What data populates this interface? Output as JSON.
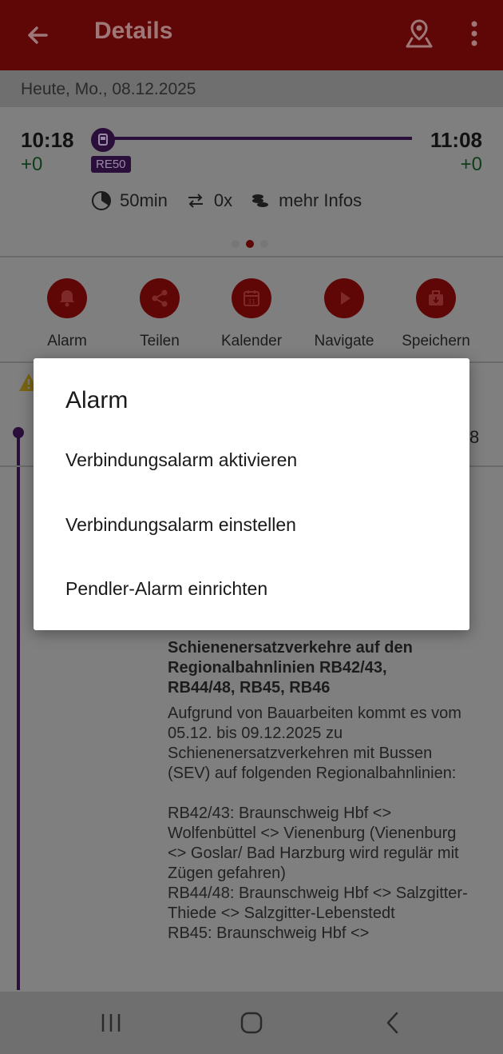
{
  "appbar": {
    "title": "Details"
  },
  "date_label": "Heute, Mo., 08.12.2025",
  "journey": {
    "departure_time": "10:18",
    "departure_delay": "+0",
    "arrival_time": "11:08",
    "arrival_delay": "+0",
    "train_badge": "RE50",
    "duration": "50min",
    "transfers": "0x",
    "more_info": "mehr Infos",
    "page_dots_active": 1
  },
  "actions": [
    {
      "label": "Alarm",
      "icon": "bell-icon"
    },
    {
      "label": "Teilen",
      "icon": "share-icon"
    },
    {
      "label": "Kalender",
      "icon": "calendar-icon"
    },
    {
      "label": "Navigate",
      "icon": "play-icon"
    },
    {
      "label": "Speichern",
      "icon": "save-icon"
    }
  ],
  "calendar_day": "31",
  "content": {
    "edge_digit": "8",
    "notice_title": "Schienenersatzverkehre auf den Regionalbahnlinien RB42/43, RB44/48, RB45, RB46",
    "notice_body": "Aufgrund von Bauarbeiten kommt es vom 05.12. bis 09.12.2025 zu Schienenersatzverkehren mit Bussen (SEV) auf folgenden Regionalbahnlinien:\n\nRB42/43: Braunschweig Hbf <> Wolfenbüttel <> Vienenburg (Vienenburg <> Goslar/ Bad Harzburg wird regulär mit Zügen gefahren)\nRB44/48: Braunschweig Hbf <> Salzgitter-Thiede <> Salzgitter-Lebenstedt\nRB45: Braunschweig Hbf <>"
  },
  "dialog": {
    "title": "Alarm",
    "options": [
      "Verbindungsalarm aktivieren",
      "Verbindungsalarm einstellen",
      "Pendler-Alarm einrichten"
    ]
  },
  "colors": {
    "brand_red": "#b71c1c",
    "line_purple": "#4a1a6e",
    "delay_green": "#1e7a35"
  }
}
